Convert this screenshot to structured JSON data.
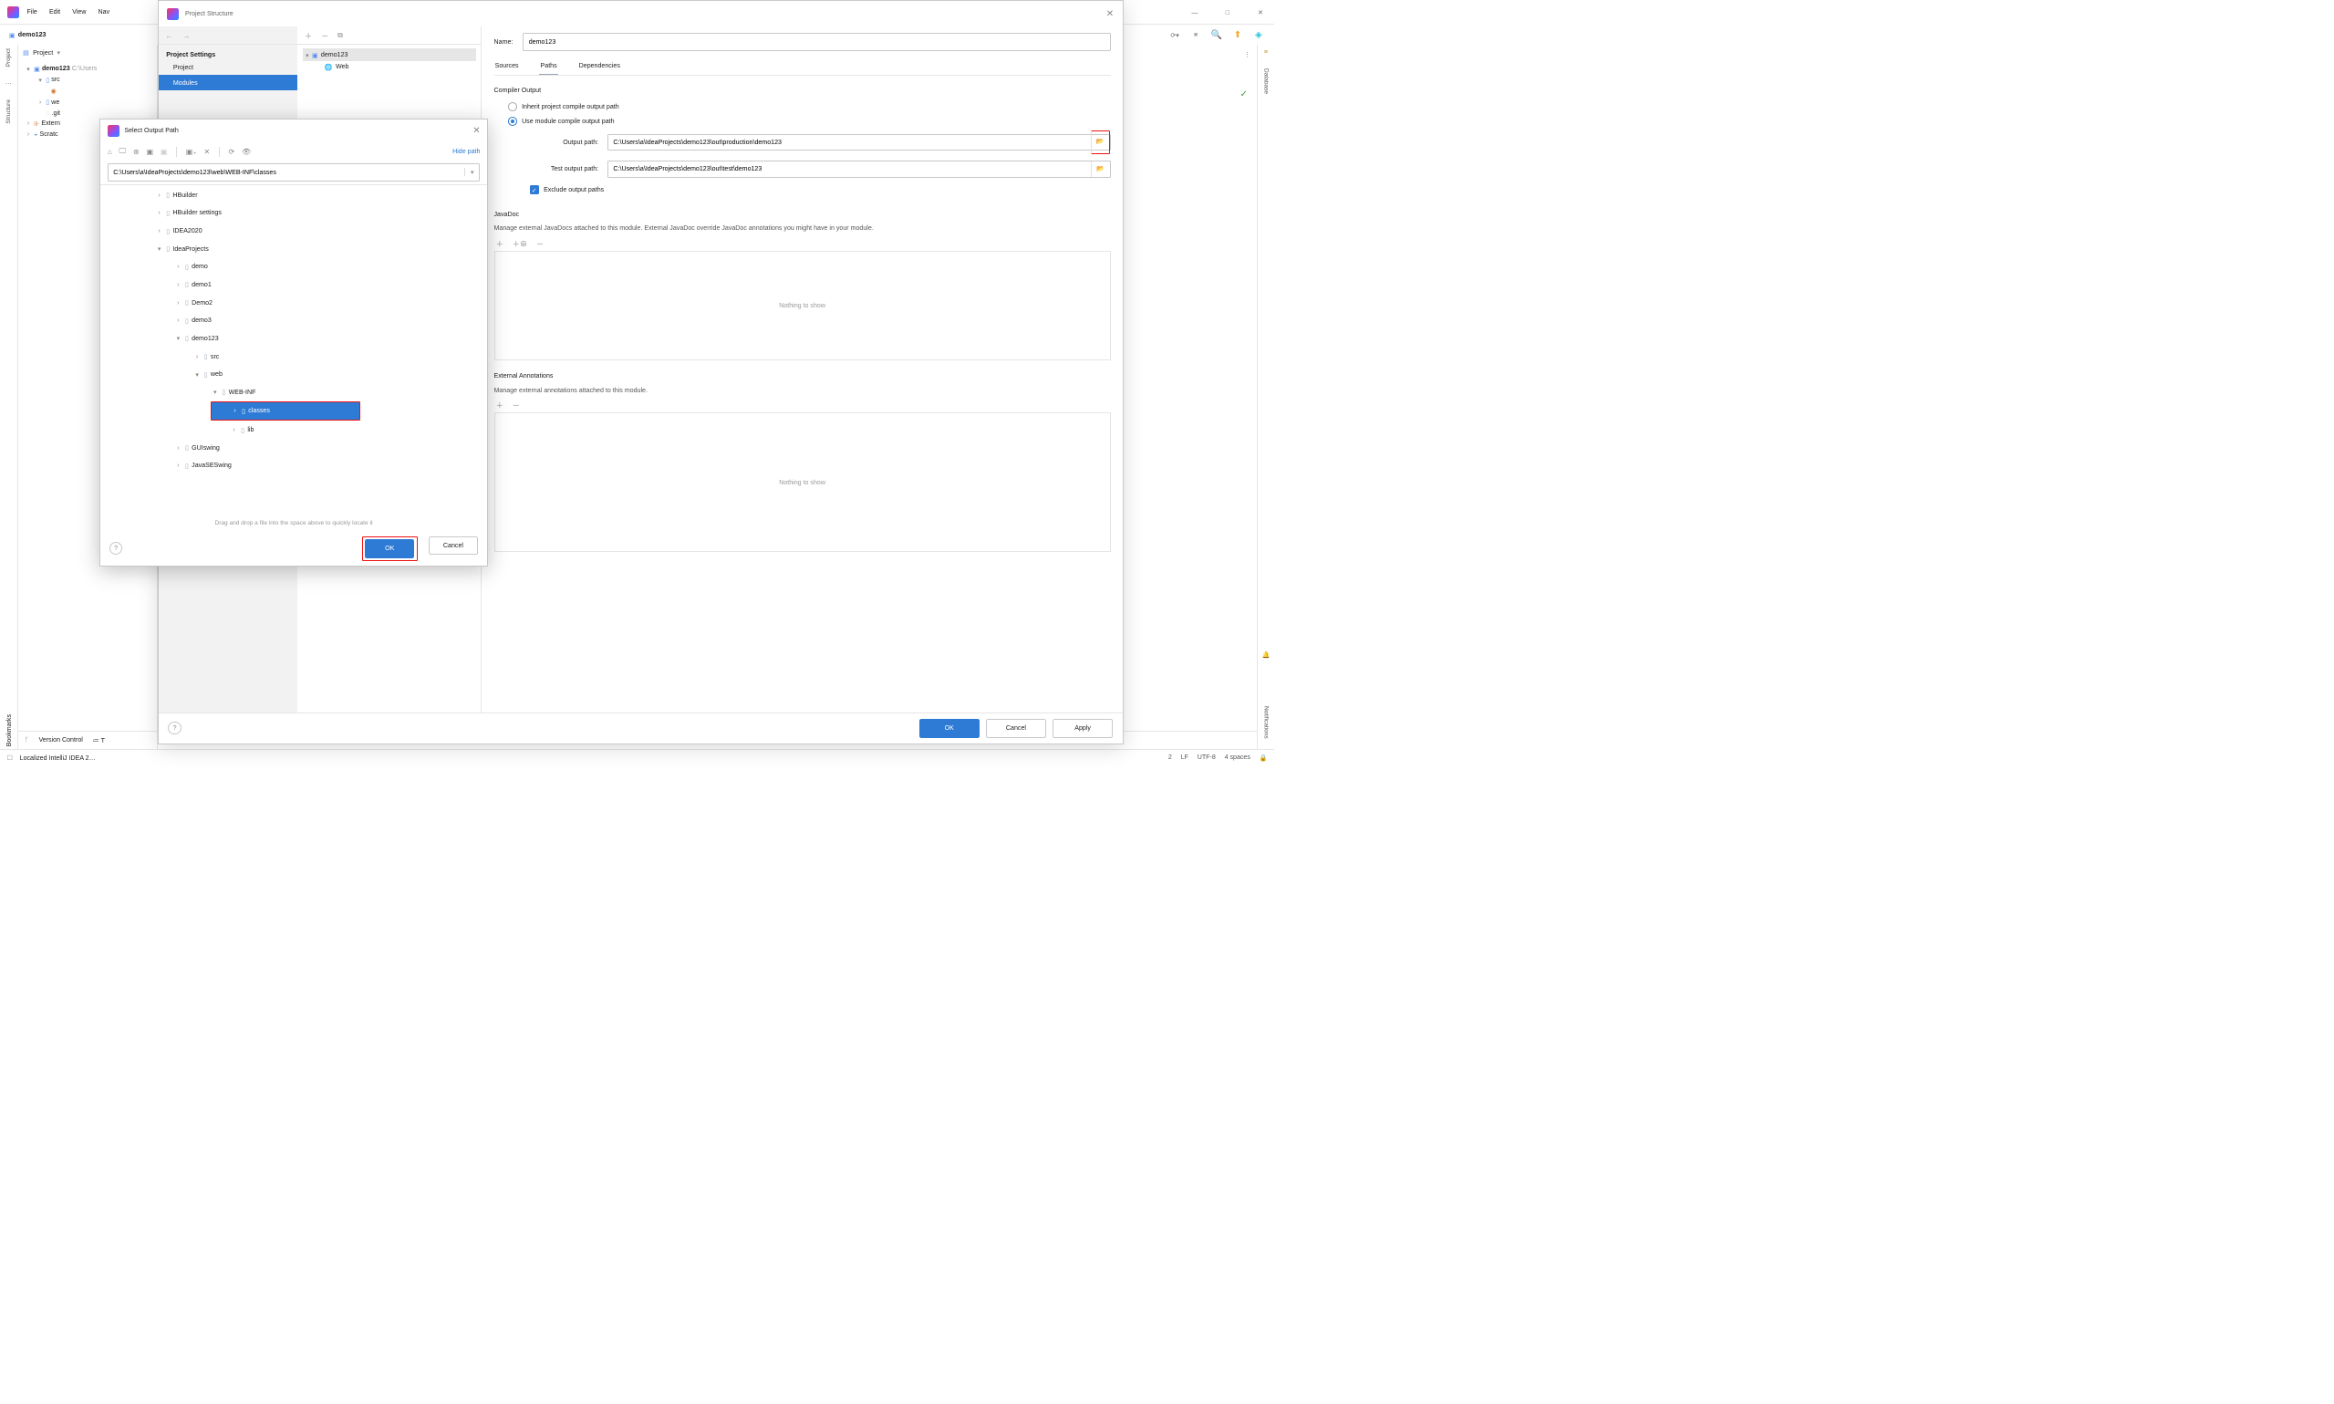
{
  "menu": {
    "file": "File",
    "edit": "Edit",
    "view": "View",
    "nav": "Nav"
  },
  "breadcrumb": {
    "project": "demo123"
  },
  "project_pane": {
    "title": "Project",
    "root": "demo123",
    "root_path": "C:\\Users",
    "children": {
      "src": "src",
      "web": "we",
      "git": ".git",
      "ext": "Extern",
      "scratch": "Scratc"
    }
  },
  "sidebars": {
    "left_top": "Project",
    "left_mid": "Structure",
    "left_bottom": "Bookmarks",
    "right_top": "Database",
    "right_bottom": "Notifications"
  },
  "bottom_tools": {
    "vcs": "Version Control",
    "todo_prefix": "T"
  },
  "status_bar": {
    "msg": "Localized IntelliJ IDEA 2…",
    "line": "2",
    "lf": "LF",
    "enc": "UTF-8",
    "indent": "4 spaces"
  },
  "ps": {
    "title": "Project Structure",
    "left": {
      "heading": "Project Settings",
      "project": "Project",
      "modules": "Modules"
    },
    "mid": {
      "module": "demo123",
      "web_facet": "Web"
    },
    "right": {
      "name_label": "Name:",
      "name_value": "demo123",
      "tabs": {
        "sources": "Sources",
        "paths": "Paths",
        "deps": "Dependencies"
      },
      "compiler_output": "Compiler Output",
      "inherit": "Inherit project compile output path",
      "use_module": "Use module compile output path",
      "output_path_label": "Output path:",
      "output_path_value": "C:\\Users\\a\\IdeaProjects\\demo123\\out\\production\\demo123",
      "test_path_label": "Test output path:",
      "test_path_value": "C:\\Users\\a\\IdeaProjects\\demo123\\out\\test\\demo123",
      "exclude": "Exclude output paths",
      "javadoc_title": "JavaDoc",
      "javadoc_desc": "Manage external JavaDocs attached to this module. External JavaDoc override JavaDoc annotations you might have in your module.",
      "nothing": "Nothing to show",
      "ext_ann_title": "External Annotations",
      "ext_ann_desc": "Manage external annotations attached to this module."
    },
    "footer": {
      "ok": "OK",
      "cancel": "Cancel",
      "apply": "Apply"
    }
  },
  "sop": {
    "title": "Select Output Path",
    "hide_path": "Hide path",
    "path_value": "C:\\Users\\a\\IdeaProjects\\demo123\\web\\WEB-INF\\classes",
    "tree": {
      "hbuilder": "HBuilder",
      "hbuilder_settings": "HBuilder settings",
      "idea2020": "IDEA2020",
      "ideaprojects": "IdeaProjects",
      "demo": "demo",
      "demo1": "demo1",
      "demo2": "Demo2",
      "demo3": "demo3",
      "demo123": "demo123",
      "src": "src",
      "web": "web",
      "webinf": "WEB-INF",
      "classes": "classes",
      "lib": "lib",
      "guiswing": "GUIswing",
      "javaseswing": "JavaSESwing"
    },
    "hint": "Drag and drop a file into the space above to quickly locate it",
    "footer": {
      "ok": "OK",
      "cancel": "Cancel"
    }
  }
}
